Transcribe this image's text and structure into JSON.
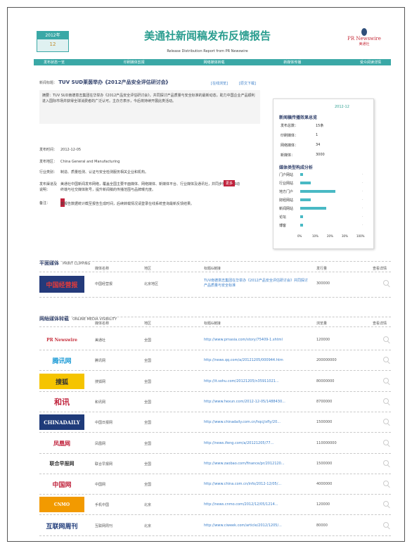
{
  "header": {
    "date_box_label": "2012年",
    "date_box_value": "12",
    "title": "美通社新闻稿发布反馈报告",
    "subtitle": "Release Distribution Report from PR Newswire",
    "logo_text": "PR Newswire",
    "logo_sub": "美通社",
    "nav": [
      "发布状态一览",
      "印刷媒体剪报",
      "网络媒体转载",
      "新媒体传播",
      "受众阅读详情"
    ]
  },
  "release": {
    "title_label": "新闻标题：",
    "title": "TUV SUD莱茵举办《2012产品安全评估研讨会》",
    "links": [
      "[在线浏览]",
      "[原文下载]"
    ],
    "summary": "摘要：TUV SUD南德意志集团在华举办《2012产品安全评估研讨会》，共同探讨产品质量与安全标准的最新动态，助力中国企业产品顺利进入国际市场并获得全球消费者的广泛认可。主办方表示，今后将持续开展此类活动。",
    "info_rows": [
      {
        "label": "发布时间：",
        "value": "2012-12-05"
      },
      {
        "label": "发布地区：",
        "value": "China General and Manufacturing"
      },
      {
        "label": "行业类别：",
        "value": "制造、质量检测、认证与安全检测服务相关企业和机构。"
      },
      {
        "label": "发布渠道及说明：",
        "value": "美通社中国新闻发布网络，覆盖全国主要平面媒体、网络媒体、新媒体平台、行业媒体及通讯社，并同步推送至移动终端与社交媒体账号，提升新闻稿的传播范围与品牌曝光度。"
      },
      {
        "label": "备注：",
        "value": "本报告数据统计截至报告生成时间，后续转载情况请登录在线系统查询最新反馈结果。"
      }
    ],
    "more_badge": "更多"
  },
  "stats": {
    "title": "新闻稿传播效果总览",
    "badge": "2012-12",
    "rows": [
      {
        "label": "发布总数：",
        "value": "15条"
      },
      {
        "label": "印刷媒体：",
        "value": "1"
      },
      {
        "label": "网络媒体：",
        "value": "34"
      },
      {
        "label": "新媒体：",
        "value": "3000"
      }
    ],
    "dist_title": "媒体类型构成分析",
    "categories": [
      "门户网站",
      "行业网站",
      "地方门户",
      "财经网站",
      "新闻网站",
      "论坛",
      "博客"
    ],
    "axis": [
      "0%",
      "10%",
      "20%",
      "30%",
      "100%"
    ]
  },
  "chart_data": {
    "type": "bar",
    "title": "媒体类型构成分析",
    "categories": [
      "门户网站",
      "行业网站",
      "地方门户",
      "财经网站",
      "新闻网站",
      "论坛",
      "博客"
    ],
    "values": [
      2,
      8,
      27,
      8,
      20,
      2,
      2
    ],
    "xlabel": "",
    "ylabel": "",
    "ylim": [
      0,
      100
    ],
    "grid": false
  },
  "print": {
    "section_title": "平面媒体",
    "section_sub": "PRINT CLIPPING",
    "headers": [
      "媒体名称",
      "地区",
      "标题&链接",
      "发行量",
      "查看详情"
    ],
    "rows": [
      {
        "logo": "中国经营报",
        "name": "中国经营报",
        "region": "北京地区",
        "title": "TUV南德意志集团在华举办《2012产品安全评估研讨会》共同探讨产品质量与安全标准",
        "count": "300000"
      }
    ]
  },
  "online": {
    "section_title": "网络媒体转载",
    "section_sub": "ONLINE MEDIA VISIBILITY",
    "headers": [
      "媒体名称",
      "地区",
      "标题&链接",
      "浏览量",
      "查看详情"
    ],
    "rows": [
      {
        "logo": "PR Newswire",
        "name": "美通社",
        "region": "全国",
        "url": "http://www.prnasia.com/story/75409-1.shtml",
        "count": "120000"
      },
      {
        "logo": "腾讯网",
        "name": "腾讯网",
        "region": "全国",
        "url": "http://news.qq.com/a/20121205/000944.htm",
        "count": "200000000"
      },
      {
        "logo": "搜狐",
        "name": "搜狐网",
        "region": "全国",
        "url": "http://it.sohu.com/20121205/n35911021...",
        "count": "80000000"
      },
      {
        "logo": "和讯",
        "name": "和讯网",
        "region": "全国",
        "url": "http://www.hexun.com/2012-12-05/1488430...",
        "count": "8700000"
      },
      {
        "logo": "CHINADAILY",
        "name": "中国日报网",
        "region": "全国",
        "url": "http://www.chinadaily.com.cn/hqcj/xfly/20...",
        "count": "1500000"
      },
      {
        "logo": "凤凰网",
        "name": "凤凰网",
        "region": "全国",
        "url": "http://news.ifeng.com/a/20121205/77...",
        "count": "110000000"
      },
      {
        "logo": "联合早报网",
        "name": "联合早报网",
        "region": "全国",
        "url": "http://www.zaobao.com/finance/pr/2012120...",
        "count": "1500000"
      },
      {
        "logo": "中国网",
        "name": "中国网",
        "region": "全国",
        "url": "http://www.china.com.cn/info/2012-12/05/...",
        "count": "4000000"
      },
      {
        "logo": "CNMO",
        "name": "手机中国",
        "region": "北京",
        "url": "http://news.cnmo.com/2012/12/05/1214...",
        "count": "120000"
      },
      {
        "logo": "互联网周刊",
        "name": "互联网周刊",
        "region": "北京",
        "url": "http://www.ciweek.com/article/2012/1205/...",
        "count": "80000"
      }
    ]
  }
}
